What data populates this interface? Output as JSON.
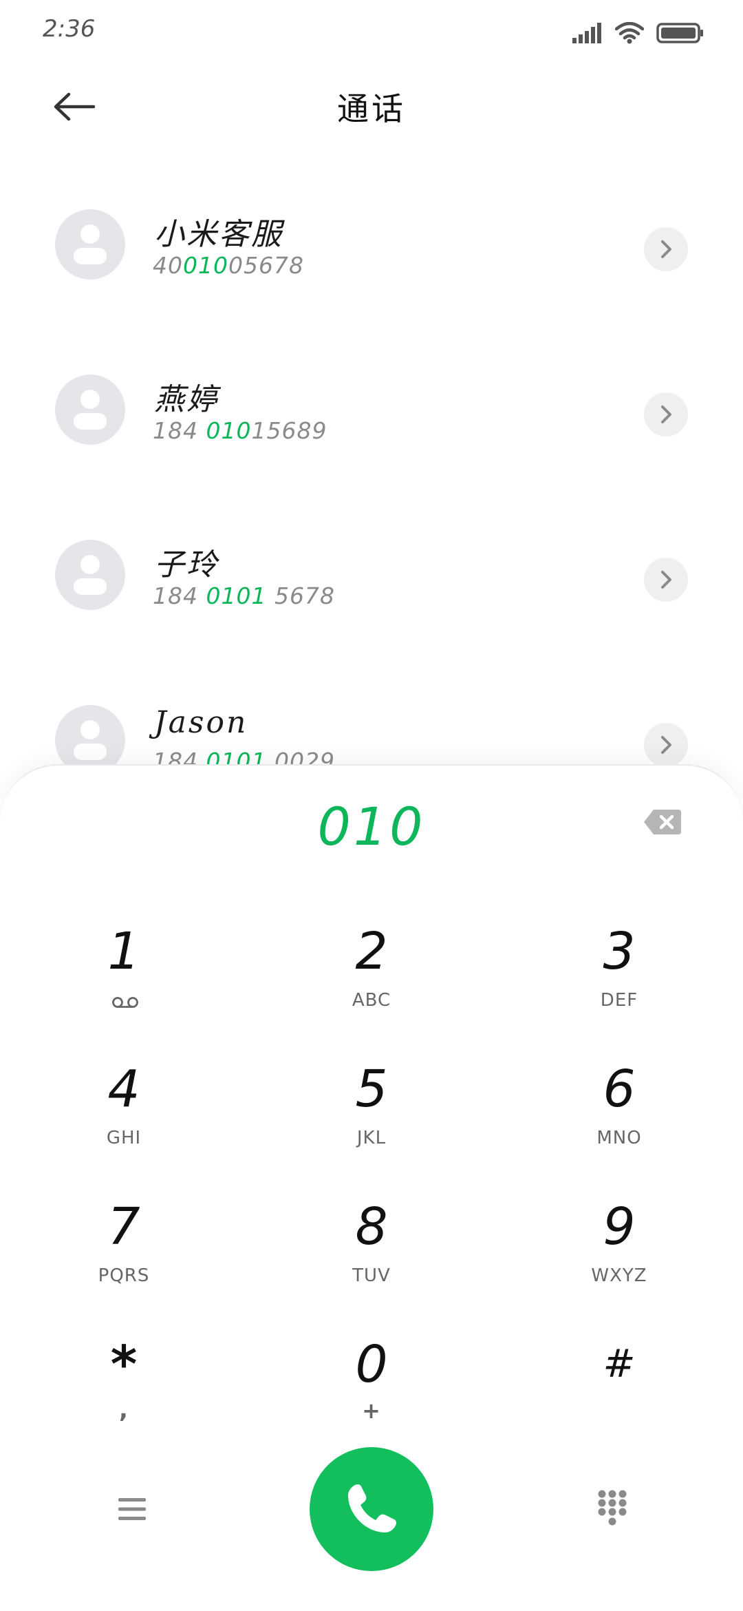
{
  "status_bar": {
    "time": "2:36",
    "icons": [
      "signal-icon",
      "wifi-icon",
      "battery-icon"
    ]
  },
  "header": {
    "title": "通话",
    "back_icon": "arrow-left-icon"
  },
  "contacts": [
    {
      "name": "小米客服",
      "number_before": "40",
      "number_match": "010",
      "number_after": "05678"
    },
    {
      "name": "燕婷",
      "number_before": "184 ",
      "number_match": "010",
      "number_after": "15689"
    },
    {
      "name": "子玲",
      "number_before": "184 ",
      "number_match": "0101",
      "number_after": " 5678"
    },
    {
      "name": "Jason",
      "number_before": "184 ",
      "number_match": "0101",
      "number_after": " 0029"
    }
  ],
  "dialer": {
    "input": "010",
    "keys": [
      {
        "digit": "1",
        "letters": ""
      },
      {
        "digit": "2",
        "letters": "ABC"
      },
      {
        "digit": "3",
        "letters": "DEF"
      },
      {
        "digit": "4",
        "letters": "GHI"
      },
      {
        "digit": "5",
        "letters": "JKL"
      },
      {
        "digit": "6",
        "letters": "MNO"
      },
      {
        "digit": "7",
        "letters": "PQRS"
      },
      {
        "digit": "8",
        "letters": "TUV"
      },
      {
        "digit": "9",
        "letters": "WXYZ"
      },
      {
        "digit": "*",
        "letters": ","
      },
      {
        "digit": "0",
        "letters": "+"
      },
      {
        "digit": "#",
        "letters": ""
      }
    ]
  },
  "colors": {
    "accent": "#0db65a",
    "call_button": "#12bf5c",
    "avatar_bg": "#e4e6ea"
  }
}
